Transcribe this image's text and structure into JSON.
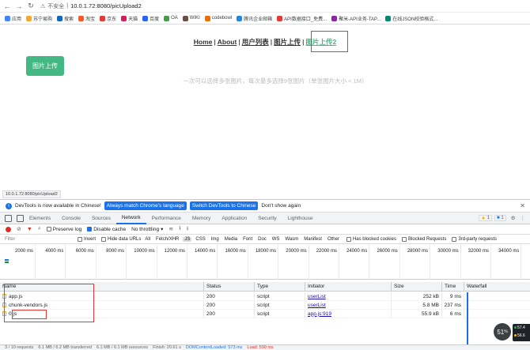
{
  "browser": {
    "insecure_label": "不安全",
    "url": "10.0.1.72:8080/picUpload2",
    "bookmarks": [
      {
        "label": "应用",
        "color": "#4285f4"
      },
      {
        "label": "苏宁易购",
        "color": "#f9a825"
      },
      {
        "label": "搜索",
        "color": "#1565c0"
      },
      {
        "label": "淘宝",
        "color": "#ff5722"
      },
      {
        "label": "京东",
        "color": "#e53935"
      },
      {
        "label": "天猫",
        "color": "#d81b60"
      },
      {
        "label": "百度",
        "color": "#2962ff"
      },
      {
        "label": "OA",
        "color": "#43a047"
      },
      {
        "label": "WIKI",
        "color": "#6d4c41"
      },
      {
        "label": "codebowl",
        "color": "#ef6c00"
      },
      {
        "label": "腾讯企业邮箱",
        "color": "#1e88e5"
      },
      {
        "label": "API数据接口_免费...",
        "color": "#e53935"
      },
      {
        "label": "聚米-API业务-TAP...",
        "color": "#8e24aa"
      },
      {
        "label": "在线JSON校验格式...",
        "color": "#00897b"
      }
    ]
  },
  "page": {
    "nav": {
      "home": "Home",
      "about": "About",
      "users": "用户列表",
      "upload1": "图片上传",
      "upload2": "图片上传2",
      "sep": "|"
    },
    "upload_button": "图片上传",
    "hint": "一次可以选择多张图片，每次最多选择9张图片（单张图片大小 < 1M）",
    "status_url": "10.0.1.72:8080/picUpload2"
  },
  "devtools": {
    "info": {
      "icon": "i",
      "message": "DevTools is now available in Chinese!",
      "match_btn": "Always match Chrome's language",
      "switch_btn": "Switch DevTools to Chinese",
      "dismiss": "Don't show again"
    },
    "tabs": [
      "Elements",
      "Console",
      "Sources",
      "Network",
      "Performance",
      "Memory",
      "Application",
      "Security",
      "Lighthouse"
    ],
    "active_tab": "Network",
    "warn_count": "1",
    "msg_count": "1",
    "toolbar": {
      "preserve_log": "Preserve log",
      "disable_cache": "Disable cache",
      "throttling": "No throttling"
    },
    "filter": {
      "placeholder": "Filter",
      "invert": "Invert",
      "hide_data_urls": "Hide data URLs",
      "types": [
        "All",
        "Fetch/XHR",
        "JS",
        "CSS",
        "Img",
        "Media",
        "Font",
        "Doc",
        "WS",
        "Wasm",
        "Manifest",
        "Other"
      ],
      "active_type": "JS",
      "blocked_cookies": "Has blocked cookies",
      "blocked_requests": "Blocked Requests",
      "third_party": "3rd-party requests"
    },
    "timeline_ticks": [
      "2000 ms",
      "4000 ms",
      "6000 ms",
      "8000 ms",
      "10000 ms",
      "12000 ms",
      "14000 ms",
      "16000 ms",
      "18000 ms",
      "20000 ms",
      "22000 ms",
      "24000 ms",
      "26000 ms",
      "28000 ms",
      "30000 ms",
      "32000 ms",
      "34000 ms"
    ],
    "columns": {
      "name": "Name",
      "status": "Status",
      "type": "Type",
      "initiator": "Initiator",
      "size": "Size",
      "time": "Time",
      "waterfall": "Waterfall"
    },
    "rows": [
      {
        "name": "app.js",
        "status": "200",
        "type": "script",
        "initiator": "userList",
        "size": "252 kB",
        "time": "9 ms"
      },
      {
        "name": "chunk-vendors.js",
        "status": "200",
        "type": "script",
        "initiator": "userList",
        "size": "5.8 MB",
        "time": "237 ms"
      },
      {
        "name": "0.js",
        "status": "200",
        "type": "script",
        "initiator": "app.js:919",
        "size": "55.9 kB",
        "time": "6 ms"
      }
    ],
    "status": {
      "requests": "3 / 10 requests",
      "transferred": "6.1 MB / 6.2 MB transferred",
      "resources": "6.1 MB / 6.1 MB resources",
      "finish": "Finish: 20.61 s",
      "dcl": "DOMContentLoaded: 573 ms",
      "load": "Load: 590 ms"
    }
  },
  "overlay": {
    "badge": "51",
    "badge_unit": "%",
    "up": "57.4",
    "down": "56.6"
  }
}
